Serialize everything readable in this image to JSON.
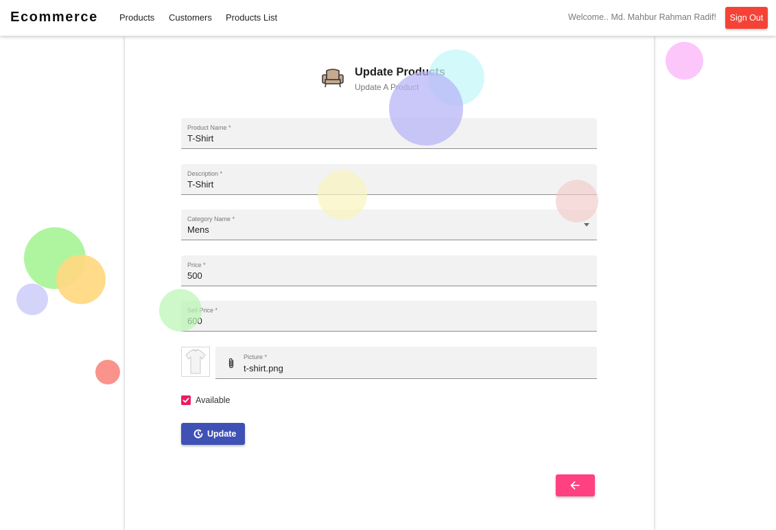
{
  "navbar": {
    "brand": "Ecommerce",
    "links": [
      "Products",
      "Customers",
      "Products List"
    ],
    "welcome": "Welcome.. Md. Mahbur Rahman Radif!",
    "signout": "Sign Out",
    "signout_color": "#f44336"
  },
  "header": {
    "icon": "armchair-icon",
    "title": "Update Products",
    "subtitle": "Update A Product"
  },
  "form": {
    "product_name": {
      "label": "Product Name *",
      "value": "T-Shirt"
    },
    "description": {
      "label": "Description *",
      "value": "T-Shirt"
    },
    "category": {
      "label": "Category Name *",
      "value": "Mens"
    },
    "price": {
      "label": "Price *",
      "value": "500"
    },
    "sell_price": {
      "label": "Sell Price *",
      "value": "600"
    },
    "picture": {
      "label": "Picture *",
      "value": "t-shirt.png",
      "icon": "paperclip-icon",
      "thumbnail": "tshirt-thumbnail"
    },
    "available": {
      "label": "Available",
      "checked": true,
      "color": "#e91e63"
    },
    "update_button": {
      "label": "Update",
      "icon": "refresh-icon",
      "color": "#3f51b5"
    },
    "back_button": {
      "icon": "arrow-left-icon",
      "color": "#ff4081"
    }
  }
}
